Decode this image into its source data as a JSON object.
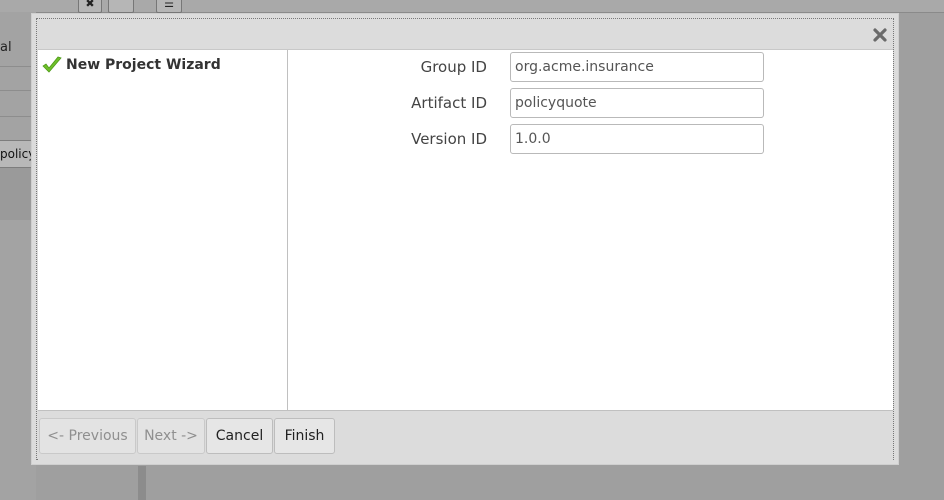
{
  "background": {
    "sidebar_text_1": "al",
    "sidebar_button": "policyquote",
    "toolbar_buttons": [
      "✖",
      "",
      "☰"
    ]
  },
  "dialog": {
    "close_icon": "close-icon",
    "steps": [
      {
        "label": "New Project Wizard",
        "icon": "checkmark-icon",
        "complete": true
      }
    ],
    "fields": {
      "group_id": {
        "label": "Group ID",
        "value": "org.acme.insurance"
      },
      "artifact_id": {
        "label": "Artifact ID",
        "value": "policyquote"
      },
      "version_id": {
        "label": "Version ID",
        "value": "1.0.0"
      }
    },
    "buttons": {
      "previous": "<- Previous",
      "next": "Next ->",
      "cancel": "Cancel",
      "finish": "Finish"
    }
  },
  "colors": {
    "overlay": "#9f9f9f",
    "dialog_bg": "#dcdcdc",
    "check_green": "#6fbf2a"
  }
}
